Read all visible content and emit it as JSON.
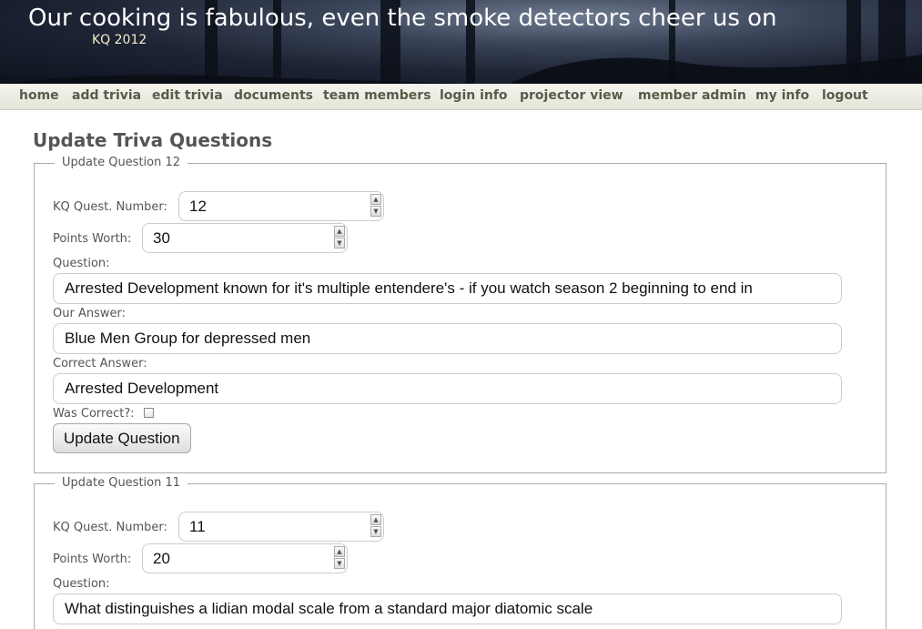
{
  "header": {
    "title": "Our cooking is fabulous, even the smoke detectors cheer us on",
    "subtitle": "KQ 2012"
  },
  "nav": {
    "items": [
      "home",
      "add trivia",
      "edit trivia",
      "documents",
      "team members",
      "login info",
      "projector view",
      "member admin",
      "my info",
      "logout"
    ]
  },
  "page": {
    "title": "Update Triva Questions"
  },
  "labels": {
    "quest_number": "KQ Quest. Number:",
    "points": "Points Worth:",
    "question": "Question:",
    "our_answer": "Our Answer:",
    "correct_answer": "Correct Answer:",
    "was_correct": "Was Correct?:",
    "update_button": "Update Question"
  },
  "questions": [
    {
      "legend": "Update Question 12",
      "number": "12",
      "points": "30",
      "question": "Arrested Development known for it's multiple entendere's - if you watch season 2 beginning to end in",
      "our_answer": "Blue Men Group for depressed men",
      "correct_answer": "Arrested Development",
      "was_correct": false
    },
    {
      "legend": "Update Question 11",
      "number": "11",
      "points": "20",
      "question": "What distinguishes a lidian modal scale from a standard major diatomic scale"
    }
  ],
  "icons": {
    "spin_up": "spin-up-arrow-icon",
    "spin_down": "spin-down-arrow-icon"
  }
}
